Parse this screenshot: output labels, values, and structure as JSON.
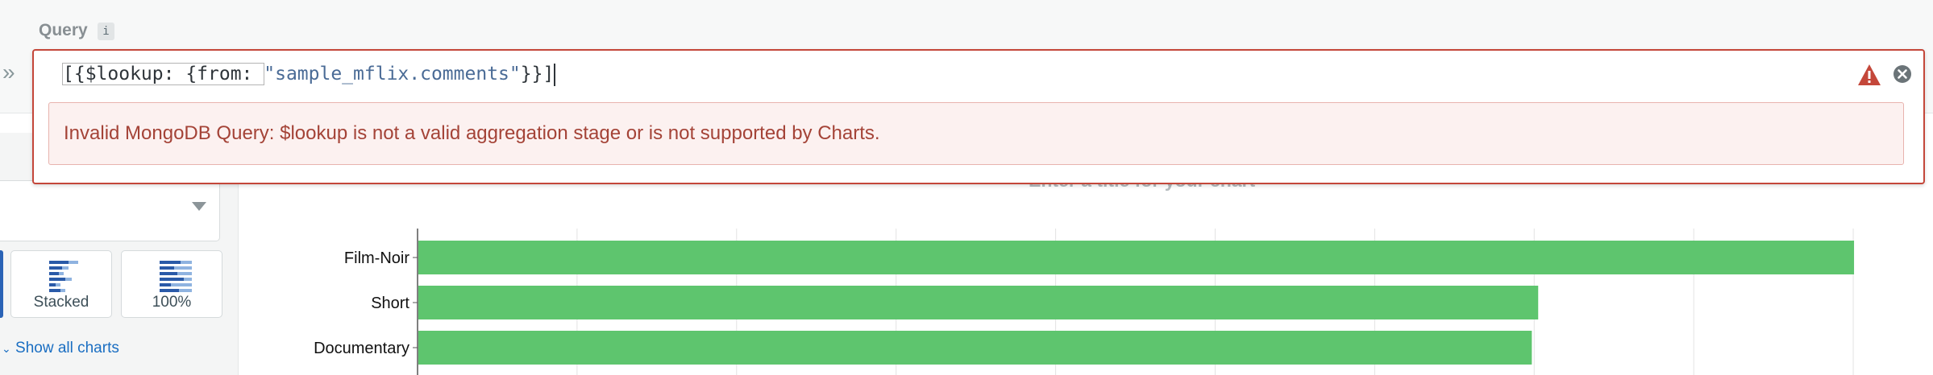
{
  "query": {
    "label": "Query",
    "info_glyph": "i",
    "collapse_glyph": "»",
    "value_prefix": "[{$lookup: {from: ",
    "value_string": "\"sample_mflix.comments\"",
    "value_suffix": "}}]",
    "error_message": "Invalid MongoDB Query: $lookup is not a valid aggregation stage or is not supported by Charts."
  },
  "chart_types": {
    "variants": [
      {
        "label": "Stacked"
      },
      {
        "label": "100%"
      }
    ],
    "show_all_label": "Show all charts"
  },
  "chart": {
    "title_placeholder": "Enter a title for your chart"
  },
  "colors": {
    "bar": "#5ec56e",
    "error": "#c4473a",
    "link": "#1a6ec2"
  },
  "chart_data": {
    "type": "bar",
    "orientation": "horizontal",
    "categories": [
      "Film-Noir",
      "Short",
      "Documentary"
    ],
    "values": [
      9.0,
      7.02,
      6.98
    ],
    "xlim": [
      0,
      9.5
    ],
    "grid": true
  }
}
